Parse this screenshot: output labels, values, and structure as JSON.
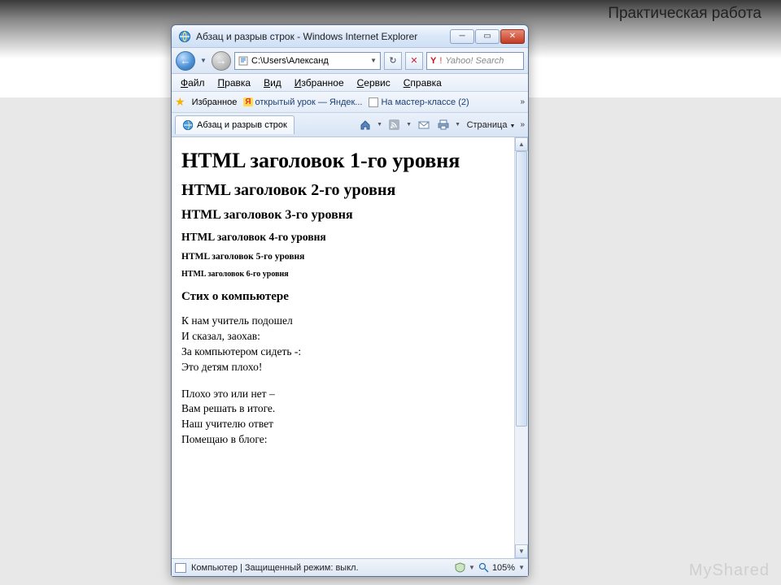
{
  "slide": {
    "title": "Практическая работа",
    "watermark": "MyShared"
  },
  "window": {
    "title": "Абзац и разрыв строк - Windows Internet Explorer"
  },
  "address": {
    "path": "C:\\Users\\Александ",
    "dropdown": "▼"
  },
  "search": {
    "placeholder": "Yahoo! Search"
  },
  "menu": {
    "file": "Файл",
    "edit": "Правка",
    "view": "Вид",
    "favorites": "Избранное",
    "service": "Сервис",
    "help": "Справка"
  },
  "favbar": {
    "label": "Избранное",
    "link1": "открытый урок — Яндек...",
    "link2": "На мастер-классе (2)"
  },
  "tab": {
    "label": "Абзац и разрыв строк",
    "page_label": "Страница"
  },
  "doc": {
    "h1": "HTML заголовок 1-го уровня",
    "h2": "HTML заголовок 2-го уровня",
    "h3": "HTML заголовок 3-го уровня",
    "h4": "HTML заголовок 4-го уровня",
    "h5": "HTML заголовок 5-го уровня",
    "h6": "HTML заголовок 6-го уровня",
    "poem_title": "Стих о компьютере",
    "stanza1": "К нам учитель подошел\nИ сказал, заохав:\nЗа компьютером сидеть -:\nЭто детям плохо!",
    "stanza2": "Плохо это или нет –\nВам решать в итоге.\nНаш учителю ответ\nПомещаю в блоге:"
  },
  "status": {
    "text": "Компьютер | Защищенный режим: выкл.",
    "zoom": "105%"
  }
}
